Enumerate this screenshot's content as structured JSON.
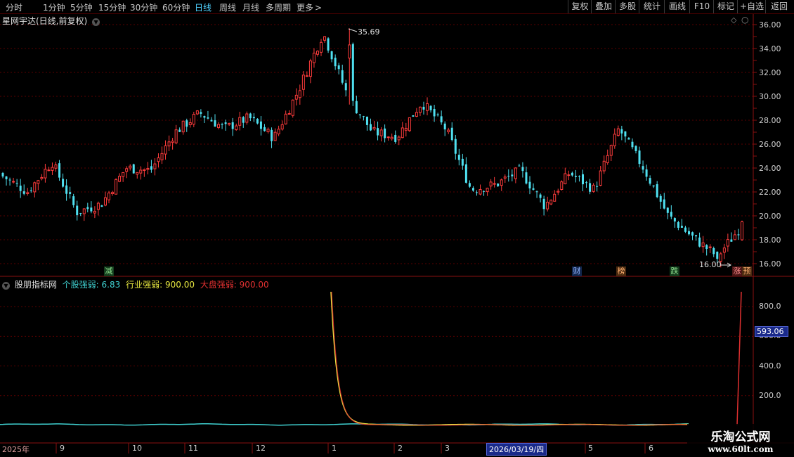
{
  "toolbar": {
    "periods": [
      "分时",
      "1分钟",
      "5分钟",
      "15分钟",
      "30分钟",
      "60分钟",
      "日线",
      "周线",
      "月线",
      "多周期",
      "更多"
    ],
    "active_period": "日线",
    "more_icon": "chevron-right-icon",
    "right_buttons": [
      "复权",
      "叠加",
      "多股",
      "统计",
      "画线",
      "F10",
      "标记",
      "+自选",
      "返回"
    ]
  },
  "main_chart": {
    "title": "星网宇达(日线,前复权)",
    "high_label": "35.69",
    "low_label": "16.00",
    "y_ticks": [
      "36.00",
      "34.00",
      "32.00",
      "30.00",
      "28.00",
      "26.00",
      "24.00",
      "22.00",
      "20.00",
      "18.00",
      "16.00"
    ],
    "events": [
      {
        "label": "减",
        "color": "#1f8a3a"
      },
      {
        "label": "财",
        "color": "#2b6cd6"
      },
      {
        "label": "榜",
        "color": "#d9782d"
      },
      {
        "label": "跌",
        "color": "#1f8a3a"
      },
      {
        "label": "涨",
        "color": "#d43c3c"
      },
      {
        "label": "预",
        "color": "#d9782d"
      }
    ]
  },
  "indicator": {
    "title": "股朋指标网",
    "series": [
      {
        "label": "个股强弱:",
        "value": "6.83",
        "color": "#3fd0d0"
      },
      {
        "label": "行业强弱:",
        "value": "900.00",
        "color": "#e8e840"
      },
      {
        "label": "大盘强弱:",
        "value": "900.00",
        "color": "#e03030"
      }
    ],
    "y_ticks": [
      "800.0",
      "600.0",
      "400.0",
      "200.0"
    ],
    "current_value": "593.06"
  },
  "x_axis": {
    "labels": [
      "2025年",
      "9",
      "10",
      "11",
      "12",
      "1",
      "2",
      "3",
      "2026/03/19/四",
      "5",
      "6"
    ]
  },
  "watermark": {
    "line1": "乐淘公式网",
    "line2": "www.60lt.com"
  },
  "chart_data": {
    "type": "candlestick",
    "ylim": [
      15.5,
      36.5
    ],
    "up_color": "#ff3c3c",
    "down_color": "#4fe0f0",
    "high": 35.69,
    "low": 16.0,
    "close_path": [
      {
        "x": "2025-08",
        "y": 23.3
      },
      {
        "x": "2025-08-mid",
        "y": 22.0
      },
      {
        "x": "2025-08-end",
        "y": 24.5
      },
      {
        "x": "2025-09-start",
        "y": 20.3
      },
      {
        "x": "2025-09-mid",
        "y": 21.0
      },
      {
        "x": "2025-09-end",
        "y": 24.0
      },
      {
        "x": "2025-10-mid",
        "y": 23.8
      },
      {
        "x": "2025-10-end",
        "y": 27.0
      },
      {
        "x": "2025-11-start",
        "y": 28.6
      },
      {
        "x": "2025-11-mid",
        "y": 27.3
      },
      {
        "x": "2025-12-start",
        "y": 28.2
      },
      {
        "x": "2025-12-mid",
        "y": 26.5
      },
      {
        "x": "2025-12-end",
        "y": 30.5
      },
      {
        "x": "2026-01-mid",
        "y": 35.3
      },
      {
        "x": "2026-01-end",
        "y": 30.0
      },
      {
        "x": "2026-02-start",
        "y": 27.0
      },
      {
        "x": "2026-02-mid",
        "y": 26.6
      },
      {
        "x": "2026-02-end",
        "y": 29.5
      },
      {
        "x": "2026-03-start",
        "y": 27.2
      },
      {
        "x": "2026-03-mid",
        "y": 22.2
      },
      {
        "x": "2026-03-19",
        "y": 22.6
      },
      {
        "x": "2026-04-start",
        "y": 23.8
      },
      {
        "x": "2026-04-mid",
        "y": 20.8
      },
      {
        "x": "2026-04-end",
        "y": 23.6
      },
      {
        "x": "2026-05-start",
        "y": 22.2
      },
      {
        "x": "2026-05-mid",
        "y": 27.3
      },
      {
        "x": "2026-05-end",
        "y": 24.0
      },
      {
        "x": "2026-06-start",
        "y": 20.0
      },
      {
        "x": "2026-06-mid",
        "y": 18.2
      },
      {
        "x": "2026-06-late",
        "y": 16.6
      },
      {
        "x": "2026-06-last",
        "y": 19.2
      }
    ]
  }
}
